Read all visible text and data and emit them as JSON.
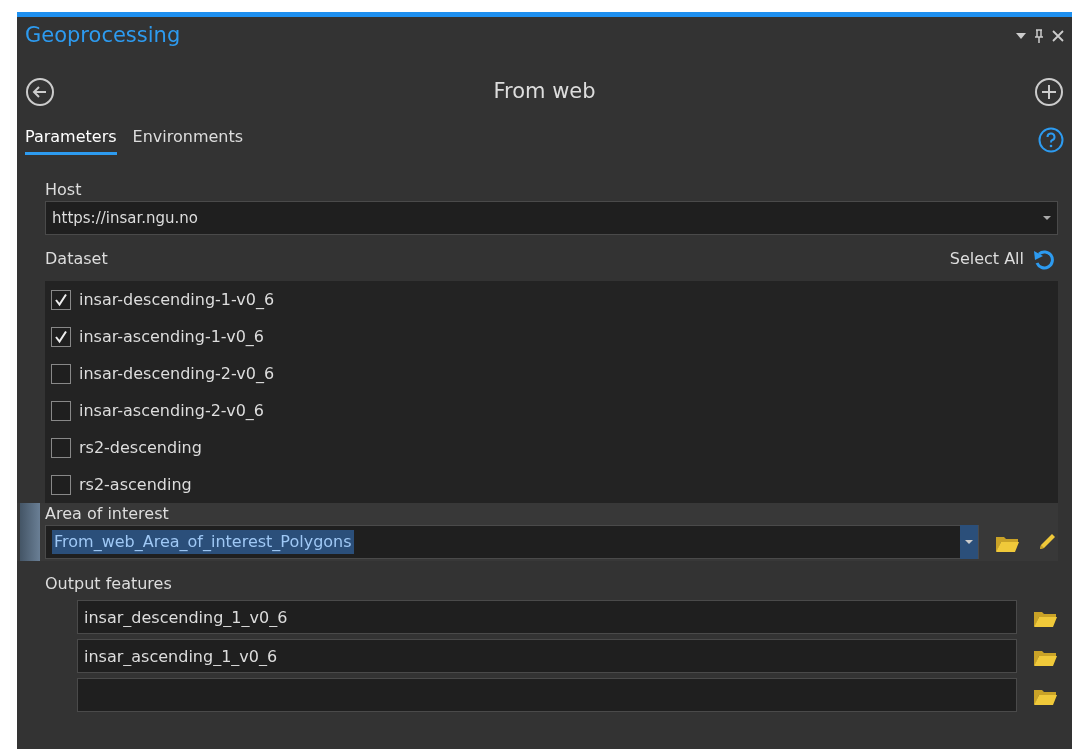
{
  "pane": {
    "title": "Geoprocessing",
    "tool_title": "From web"
  },
  "tabs": [
    {
      "label": "Parameters",
      "selected": true
    },
    {
      "label": "Environments",
      "selected": false
    }
  ],
  "host": {
    "label": "Host",
    "value": "https://insar.ngu.no"
  },
  "dataset": {
    "label": "Dataset",
    "select_all": "Select All",
    "items": [
      {
        "label": "insar-descending-1-v0_6",
        "checked": true
      },
      {
        "label": "insar-ascending-1-v0_6",
        "checked": true
      },
      {
        "label": "insar-descending-2-v0_6",
        "checked": false
      },
      {
        "label": "insar-ascending-2-v0_6",
        "checked": false
      },
      {
        "label": "rs2-descending",
        "checked": false
      },
      {
        "label": "rs2-ascending",
        "checked": false
      }
    ]
  },
  "area_of_interest": {
    "label": "Area of interest",
    "value": "From_web_Area_of_interest_Polygons",
    "active": true,
    "text_selected": true
  },
  "output_features": {
    "label": "Output features",
    "rows": [
      {
        "kind": "filled",
        "value": "insar_descending_1_v0_6"
      },
      {
        "kind": "filled",
        "value": "insar_ascending_1_v0_6"
      },
      {
        "kind": "blank"
      }
    ]
  }
}
